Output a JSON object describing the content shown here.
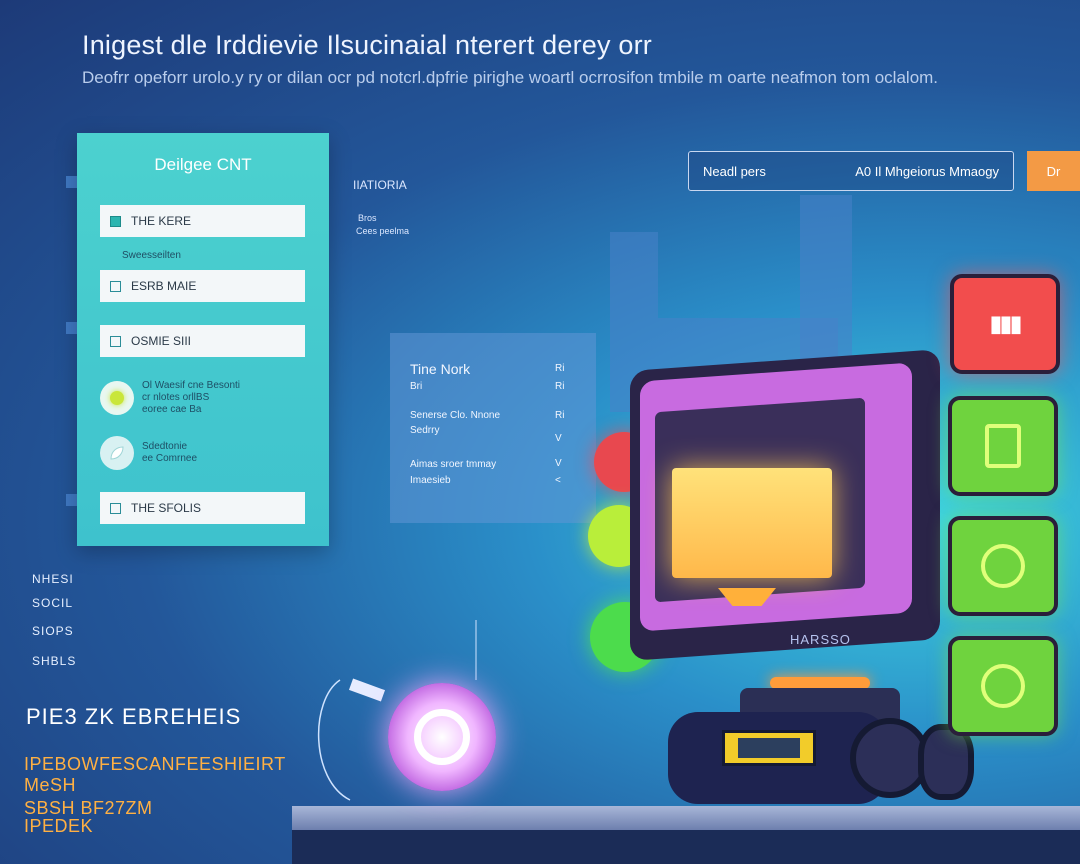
{
  "header": {
    "title": "Inigest dle Irddievie Ilsucinaial nterert derey orr",
    "subtitle": "Deofrr opeforr urolo.y ry or dilan ocr pd notcrl.dpfrie pirighe woartl ocrrosifon tmbile m oarte neafmon tom oclalom."
  },
  "card": {
    "title": "Deilgee CNT",
    "fields": [
      {
        "label": "THE KERE",
        "checked": true
      },
      {
        "label": "ESRB MAIE",
        "checked": false
      },
      {
        "label": "OSMIE SIII",
        "checked": false
      },
      {
        "label": "THE SFOLIS",
        "checked": false
      }
    ],
    "helper": "Sweesseilten",
    "radio1_lines": [
      "Ol Waesif cne Besonti",
      "cr nlotes orllBS",
      "eoree cae Ba"
    ],
    "radio2_lines": [
      "Sdedtonie",
      "ee Comrnee"
    ]
  },
  "mid": {
    "label": "IIATIORIA",
    "small1": "Bros",
    "small2": "Cees peelma"
  },
  "info_panel": {
    "title": "Tine Nork",
    "rows": [
      {
        "label": "Bri",
        "value": "Ri"
      },
      {
        "label": "Senerse Clo. Nnone",
        "value": "Ri"
      },
      {
        "label": "Sedrry",
        "value": "V"
      },
      {
        "label": "Aimas sroer tmmay",
        "value": "V"
      },
      {
        "label": "Imaesieb",
        "value": "<"
      }
    ]
  },
  "search": {
    "left_text": "Neadl pers",
    "right_text": "A0 Il Mhgeiorus Mmaogy",
    "button_label": "Dr"
  },
  "left_bottom": {
    "items": [
      "NHESI",
      "SOCIL",
      "SIOPS",
      "SHBLS"
    ],
    "heading": "PIE3 ZK EBREHEIS",
    "orange_lines": [
      "IPEBOWFESCANFEESHIEIRT",
      "MeSH",
      "SBSH BF27ZM",
      "IPEDEK"
    ]
  },
  "robot": {
    "brand": "HARSSO"
  }
}
